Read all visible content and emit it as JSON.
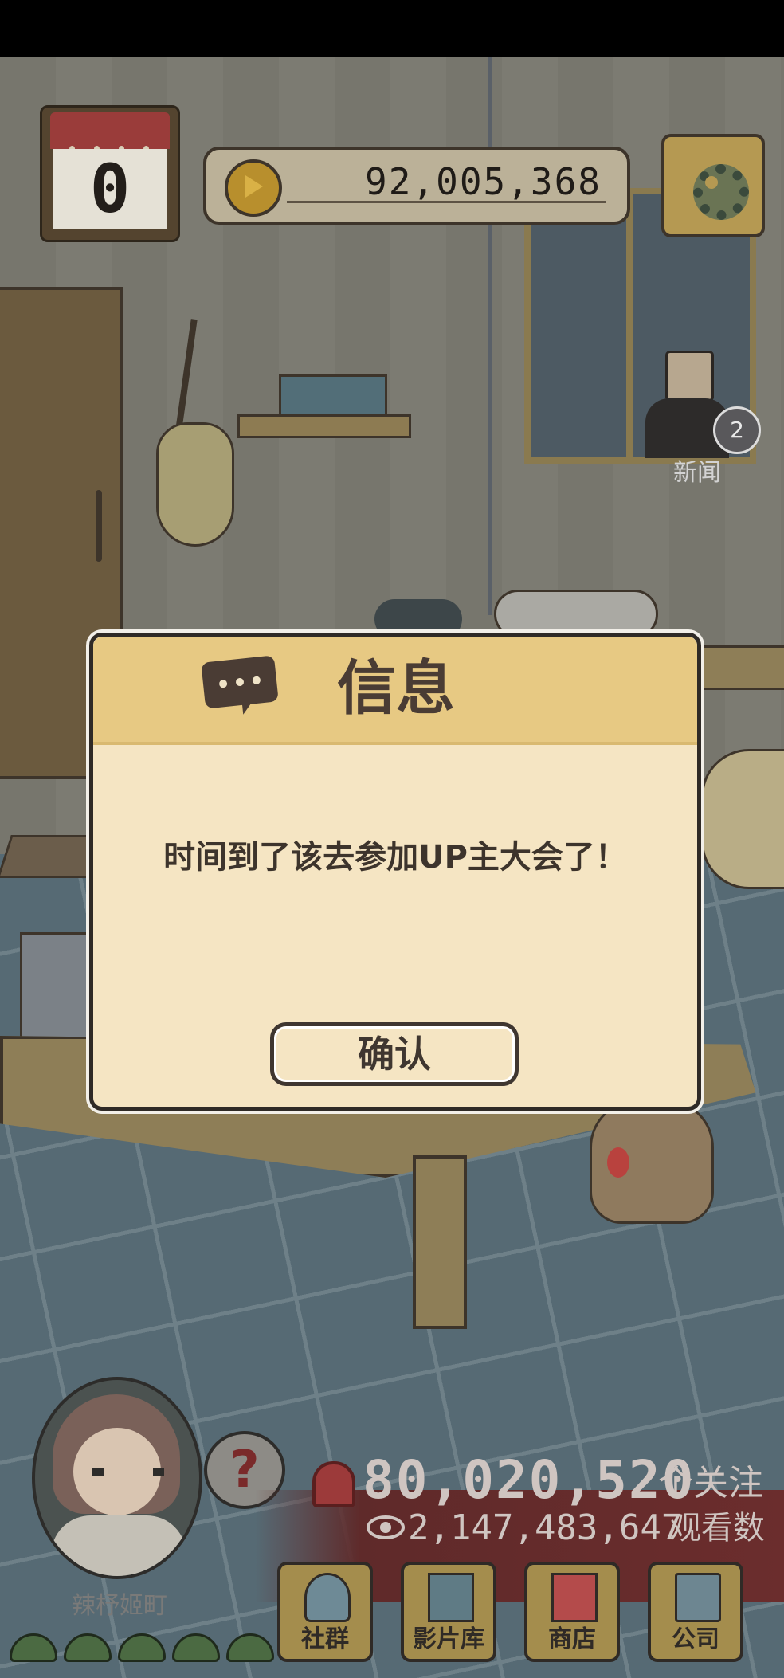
{
  "hud": {
    "day_count": "0",
    "coins": "92,005,368"
  },
  "news": {
    "count": "2",
    "label": "新闻"
  },
  "dialog": {
    "title": "信息",
    "message": "时间到了该去参加UP主大会了！",
    "confirm_label": "确认"
  },
  "profile": {
    "name": "辣杼姬町",
    "help_symbol": "?"
  },
  "stats": {
    "followers_value": "80,020,520",
    "followers_label": "个关注",
    "views_value": "2,147,483,647",
    "views_label": "观看数"
  },
  "nav": {
    "items": [
      {
        "label": "社群",
        "icon": "social-icon"
      },
      {
        "label": "影片库",
        "icon": "video-library-icon"
      },
      {
        "label": "商店",
        "icon": "shop-icon"
      },
      {
        "label": "公司",
        "icon": "company-icon"
      }
    ]
  },
  "colors": {
    "dialog_bg": "#f5e5c3",
    "dialog_header": "#e7c983",
    "stats_band": "#6b2d2d",
    "nav_button": "#a48d4d"
  }
}
